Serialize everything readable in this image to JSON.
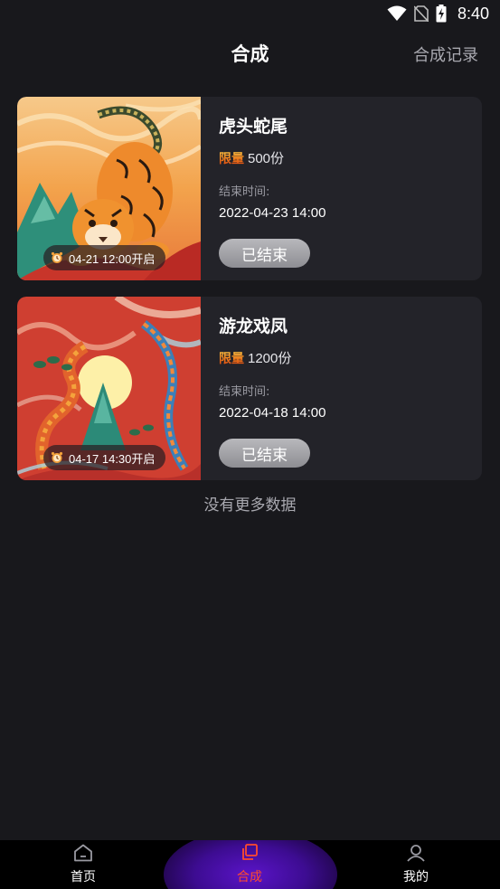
{
  "status_bar": {
    "time": "8:40",
    "icons": [
      "wifi-icon",
      "no-sim-icon",
      "battery-charging-icon"
    ]
  },
  "header": {
    "title": "合成",
    "record_link": "合成记录"
  },
  "cards": [
    {
      "title": "虎头蛇尾",
      "limit_tag": "限量",
      "limit_value": "500份",
      "end_label": "结束时间:",
      "end_time": "2022-04-23 14:00",
      "open_time": "04-21 12:00开启",
      "button_label": "已结束",
      "image": "tiger-artwork"
    },
    {
      "title": "游龙戏凤",
      "limit_tag": "限量",
      "limit_value": "1200份",
      "end_label": "结束时间:",
      "end_time": "2022-04-18 14:00",
      "open_time": "04-17 14:30开启",
      "button_label": "已结束",
      "image": "dragon-phoenix-artwork"
    }
  ],
  "list_end_text": "没有更多数据",
  "bottom_nav": {
    "items": [
      {
        "label": "首页",
        "icon": "home-icon",
        "active": false
      },
      {
        "label": "合成",
        "icon": "compose-icon",
        "active": true
      },
      {
        "label": "我的",
        "icon": "user-icon",
        "active": false
      }
    ],
    "active_color": "#ff4a2d"
  },
  "colors": {
    "background": "#18181c",
    "card": "#232329",
    "accent": "#ff4a2d",
    "nav_glow": "#5a14c8"
  }
}
